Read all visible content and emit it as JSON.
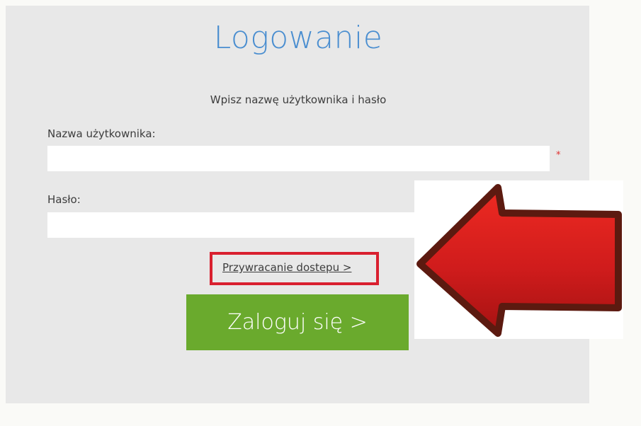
{
  "login": {
    "title": "Logowanie",
    "subtitle": "Wpisz nazwę użytkownika i hasło",
    "username_label": "Nazwa użytkownika:",
    "username_value": "",
    "required_marker": "*",
    "password_label": "Hasło:",
    "password_value": "",
    "recover_link": "Przywracanie dostepu >",
    "login_button": "Zaloguj się >"
  },
  "colors": {
    "title": "#4a8ed0",
    "button": "#6aaa2d",
    "highlight_border": "#d9202f",
    "arrow": "#d01c1c",
    "panel": "#e8e8e8"
  },
  "icons": {
    "annotation": "red-arrow-left-icon"
  }
}
